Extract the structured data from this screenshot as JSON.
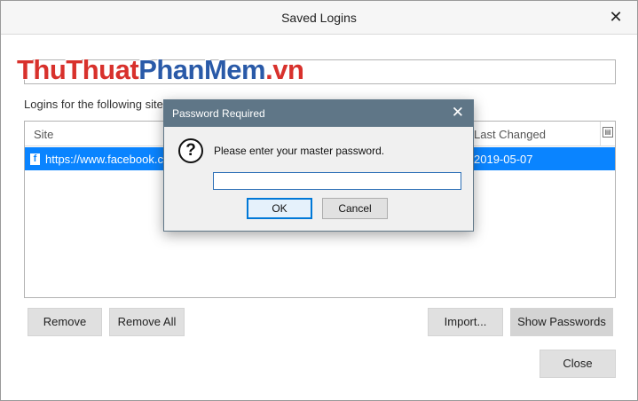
{
  "window": {
    "title": "Saved Logins",
    "close_glyph": "✕"
  },
  "watermark": {
    "part1": "ThuThuat",
    "part2": "PhanMem",
    "part3": ".vn"
  },
  "search": {
    "value": "",
    "placeholder": ""
  },
  "description": "Logins for the following sites",
  "table": {
    "columns": [
      "Site",
      "Last Changed"
    ],
    "column_picker_icon": "column-picker-icon",
    "rows": [
      {
        "site": "https://www.facebook.com",
        "last_changed": "2019-05-07",
        "icon": "facebook-icon"
      }
    ],
    "selected_row_color": "#0a84ff"
  },
  "buttons": {
    "remove": "Remove",
    "remove_all": "Remove All",
    "import": "Import...",
    "show_passwords": "Show Passwords",
    "close": "Close"
  },
  "modal": {
    "title": "Password Required",
    "close_glyph": "✕",
    "icon": "question-icon",
    "message": "Please enter your master password.",
    "password_value": "",
    "ok": "OK",
    "cancel": "Cancel",
    "titlebar_color": "#5f7687"
  }
}
